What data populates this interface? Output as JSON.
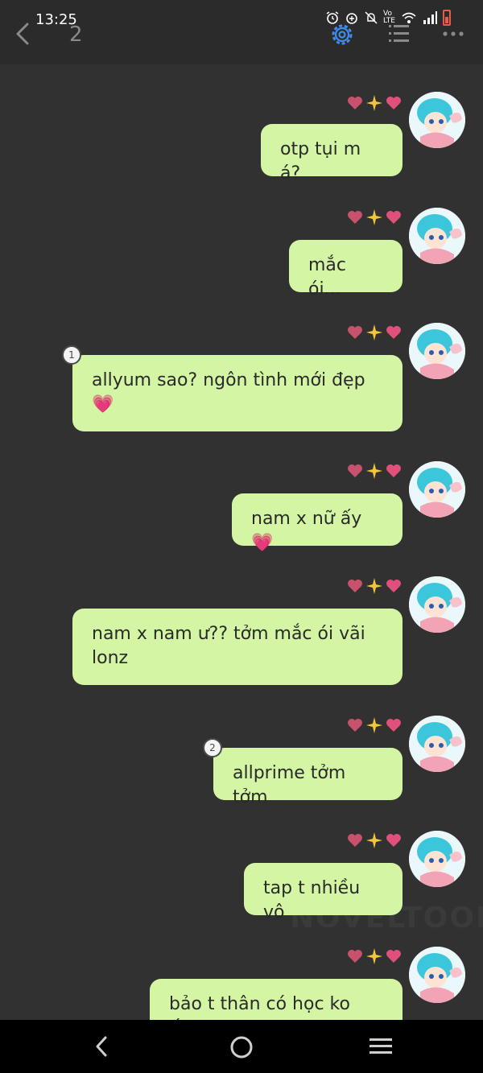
{
  "status_bar": {
    "time": "13:25",
    "icons": [
      "alarm-icon",
      "add-alarm-icon",
      "mute-icon",
      "volte-icon",
      "wifi-icon",
      "signal-icon",
      "battery-icon"
    ],
    "volte_text": "Vo LTE"
  },
  "header": {
    "chapter_number": "2",
    "accent_color": "#3d8ef0"
  },
  "messages": [
    {
      "text": "otp tụi m á?",
      "badge": null
    },
    {
      "text": "mắc ói...",
      "badge": null
    },
    {
      "text": "allyum sao? ngôn tình mới đẹp 💗",
      "badge": "1"
    },
    {
      "text": "nam x nữ ấy💗",
      "badge": null
    },
    {
      "text": "nam x nam ư?? tởm mắc ói vãi lonz",
      "badge": null
    },
    {
      "text": "allprime tởm tởm",
      "badge": "2"
    },
    {
      "text": "tap t nhiều vô",
      "badge": null
    },
    {
      "text": "bảo t thân có học ko ấy?",
      "badge": null
    }
  ],
  "colors": {
    "bubble": "#d4f5a4",
    "background": "#313131"
  },
  "watermark": "NOVELTOON"
}
